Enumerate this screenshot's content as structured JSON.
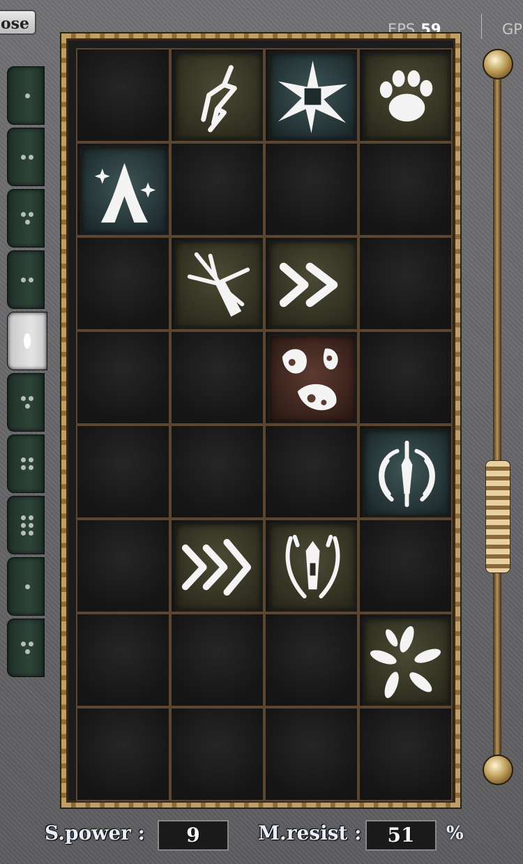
{
  "header": {
    "close_label": "ose",
    "fps_label": "EPS",
    "fps_value": "59",
    "gp_label": "GP"
  },
  "inventory": {
    "rows": 8,
    "cols": 4,
    "items": [
      {
        "row": 0,
        "col": 1,
        "icon": "lightning-rune-icon",
        "theme": "earth"
      },
      {
        "row": 0,
        "col": 2,
        "icon": "star-burst-rune-icon",
        "theme": "ice"
      },
      {
        "row": 0,
        "col": 3,
        "icon": "paw-rune-icon",
        "theme": "earth"
      },
      {
        "row": 1,
        "col": 0,
        "icon": "praying-hands-rune-icon",
        "theme": "ice"
      },
      {
        "row": 2,
        "col": 1,
        "icon": "shatter-rune-icon",
        "theme": "earth"
      },
      {
        "row": 2,
        "col": 2,
        "icon": "double-chevron-rune-icon",
        "theme": "earth"
      },
      {
        "row": 3,
        "col": 2,
        "icon": "bloodstain-rune-icon",
        "theme": "blood"
      },
      {
        "row": 4,
        "col": 3,
        "icon": "winged-shield-rune-icon",
        "theme": "ice"
      },
      {
        "row": 5,
        "col": 1,
        "icon": "triple-chevron-rune-icon",
        "theme": "earth"
      },
      {
        "row": 5,
        "col": 2,
        "icon": "horned-shield-rune-icon",
        "theme": "earth"
      },
      {
        "row": 6,
        "col": 3,
        "icon": "petal-burst-rune-icon",
        "theme": "earth"
      }
    ]
  },
  "sidebar": {
    "tabs": [
      {
        "pips": 1,
        "active": false
      },
      {
        "pips": 2,
        "active": false
      },
      {
        "pips": 3,
        "active": false
      },
      {
        "pips": 2,
        "active": false
      },
      {
        "pips": 1,
        "active": true
      },
      {
        "pips": 3,
        "active": false
      },
      {
        "pips": 4,
        "active": false
      },
      {
        "pips": 6,
        "active": false
      },
      {
        "pips": 1,
        "active": false
      },
      {
        "pips": 3,
        "active": false
      }
    ]
  },
  "stats": {
    "spower_label": "S.power :",
    "spower_value": "9",
    "mresist_label": "M.resist :",
    "mresist_value": "51",
    "percent_symbol": "%"
  },
  "colors": {
    "frame_gold": "#d7b67a",
    "rune_white": "#f4f4f4"
  }
}
